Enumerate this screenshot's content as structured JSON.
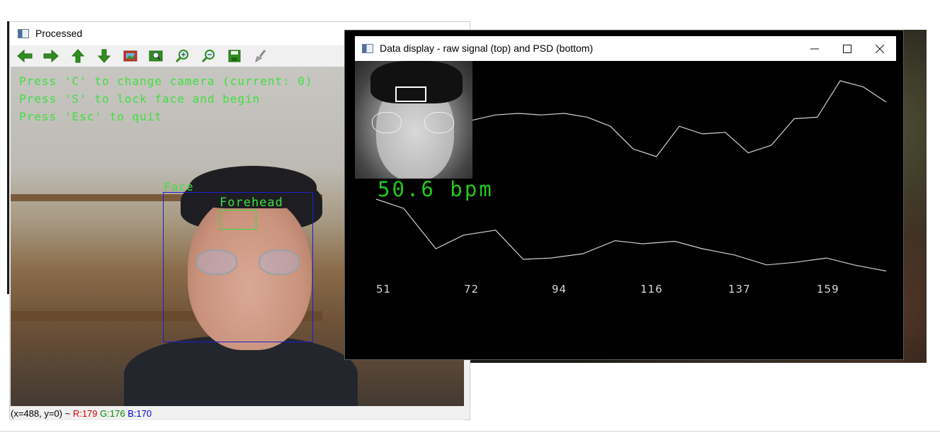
{
  "processed_window": {
    "title": "Processed",
    "toolbar": [
      {
        "name": "pan-left",
        "icon": "arrow-left-icon"
      },
      {
        "name": "pan-right",
        "icon": "arrow-right-icon"
      },
      {
        "name": "pan-up",
        "icon": "arrow-up-icon"
      },
      {
        "name": "pan-down",
        "icon": "arrow-down-icon"
      },
      {
        "name": "zoom-original",
        "icon": "image-icon"
      },
      {
        "name": "zoom-fit",
        "icon": "zoom-image-icon"
      },
      {
        "name": "zoom-in",
        "icon": "zoom-in-icon"
      },
      {
        "name": "zoom-out",
        "icon": "zoom-out-icon"
      },
      {
        "name": "save",
        "icon": "save-icon"
      },
      {
        "name": "properties",
        "icon": "brush-icon"
      }
    ],
    "overlay_lines": [
      "Press 'C' to change camera (current: 0)",
      "Press 'S' to lock face and begin",
      "Press 'Esc' to quit"
    ],
    "face_label": "Face",
    "forehead_label": "Forehead",
    "status": {
      "coords": "(x=488, y=0) ~ ",
      "r": "R:179",
      "g": "G:176",
      "b": "B:170",
      "r_color": "#e00000",
      "g_color": "#008a00",
      "b_color": "#0000e0"
    }
  },
  "data_window": {
    "title": "Data display - raw signal (top) and PSD (bottom)",
    "buttons": {
      "minimize": "—",
      "maximize": "☐",
      "close": "✕"
    },
    "bpm_text": "50.6 bpm",
    "bpm_color": "#22c81e"
  },
  "chart_data": [
    {
      "type": "line",
      "title": "raw signal",
      "series": [
        {
          "values": [
            0.48,
            0.55,
            0.57,
            0.55,
            0.57,
            0.52,
            0.4,
            0.1,
            0.0,
            0.4,
            0.3,
            0.32,
            0.05,
            0.15,
            0.5,
            0.52,
            1.0,
            0.92,
            0.72
          ]
        }
      ]
    },
    {
      "type": "line",
      "title": "PSD",
      "x_ticks": [
        "51",
        "72",
        "94",
        "116",
        "137",
        "159"
      ],
      "series": [
        {
          "x": [
            51,
            57,
            64,
            70,
            77,
            83,
            89,
            96,
            103,
            109,
            116,
            122,
            129,
            136,
            142,
            149,
            155,
            162
          ],
          "values": [
            1.0,
            0.85,
            0.2,
            0.42,
            0.5,
            0.03,
            0.05,
            0.12,
            0.33,
            0.28,
            0.32,
            0.2,
            0.1,
            -0.06,
            -0.02,
            0.05,
            -0.06,
            -0.16
          ]
        }
      ]
    }
  ]
}
